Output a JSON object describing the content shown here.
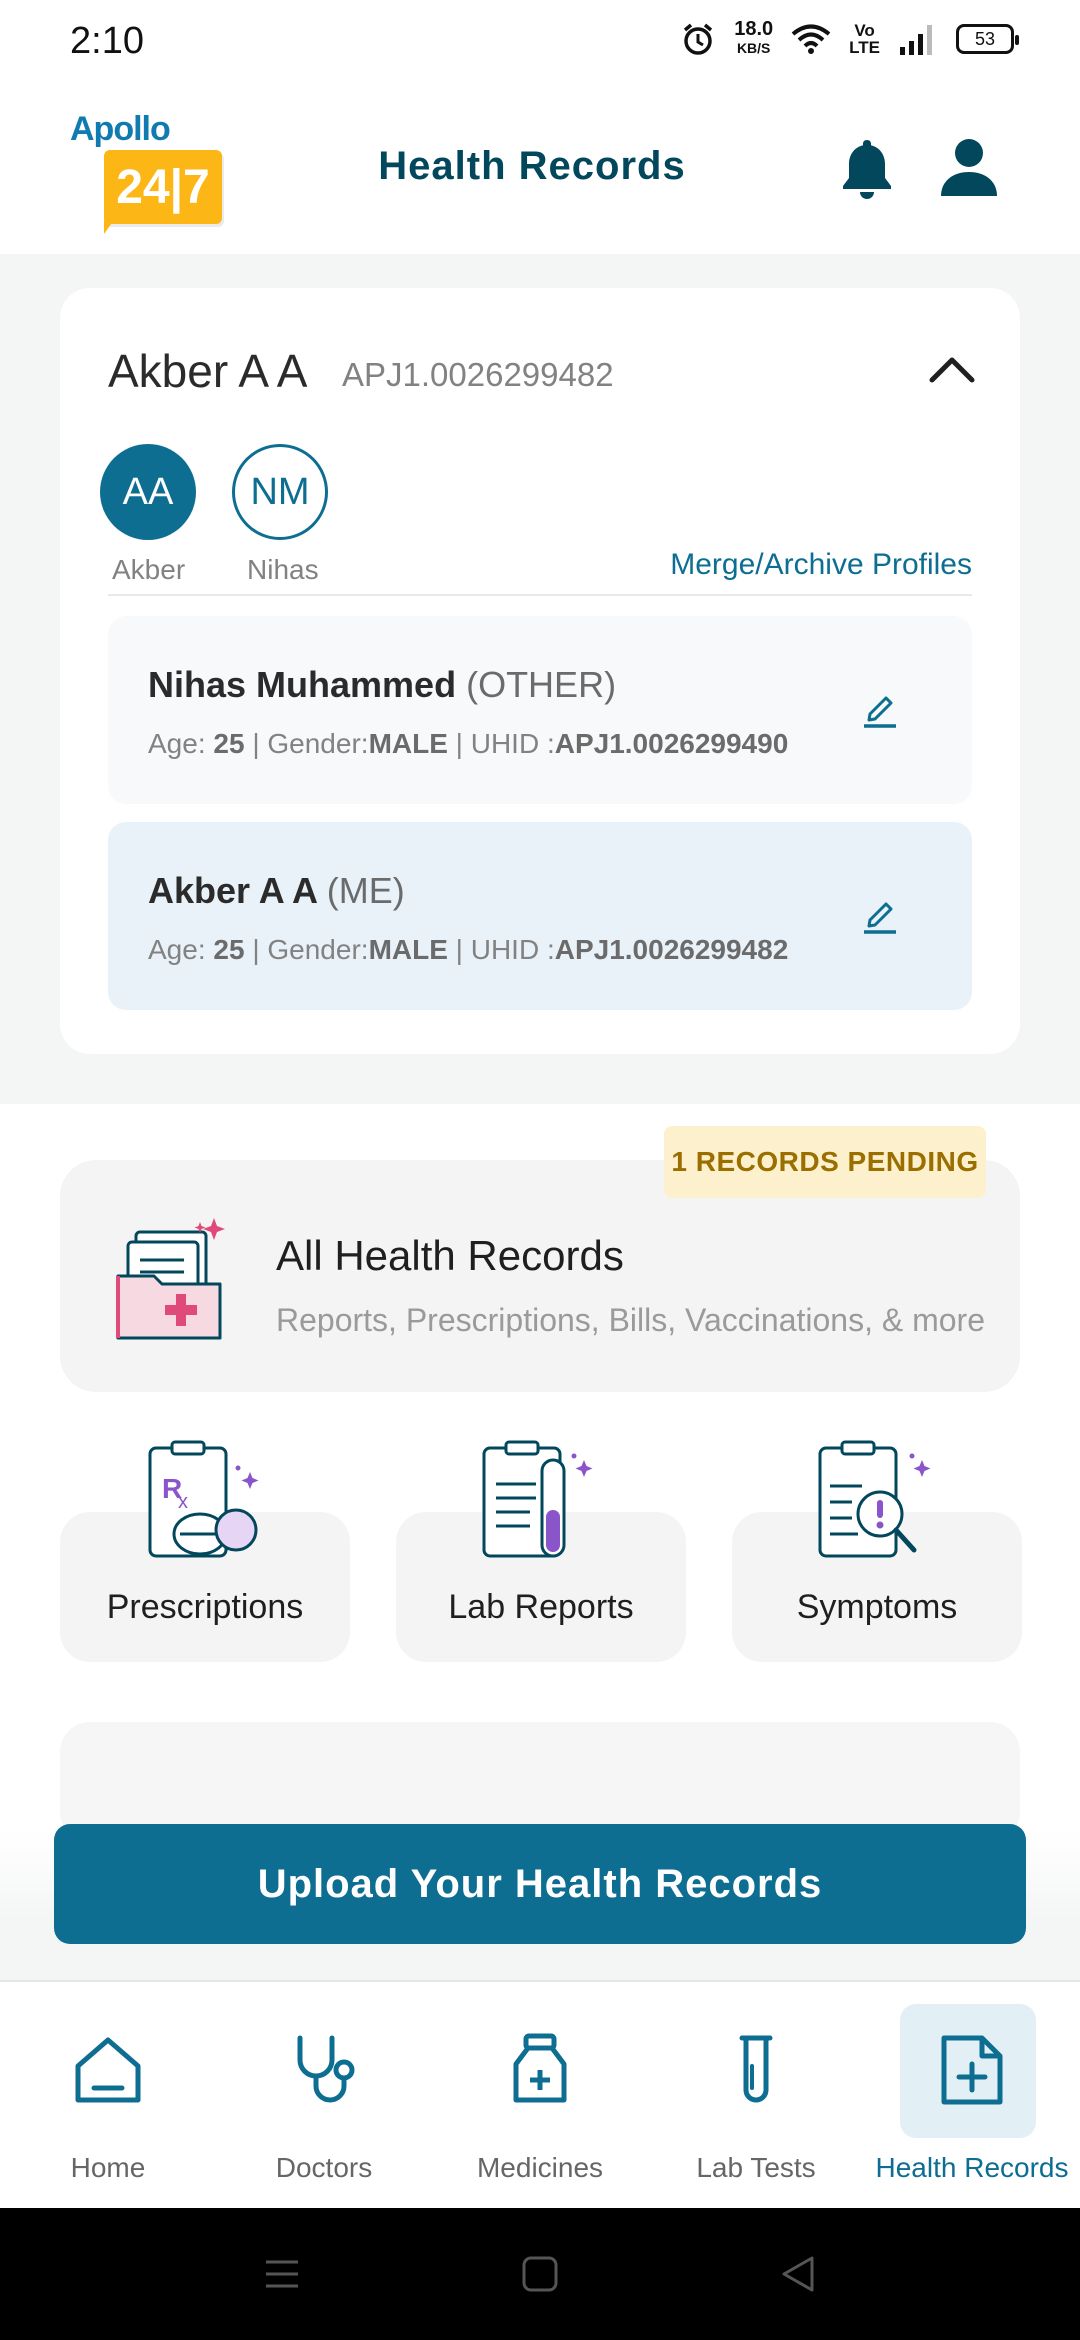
{
  "status_bar": {
    "time": "2:10",
    "net_speed_value": "18.0",
    "net_speed_unit": "KB/S",
    "volte_line1": "Vo",
    "volte_line2": "LTE",
    "battery": "53"
  },
  "header": {
    "logo_top": "Apollo",
    "logo_box": "24|7",
    "title": "Health Records"
  },
  "profile": {
    "name": "Akber A A",
    "uhid": "APJ1.0026299482",
    "avatars": [
      {
        "initials": "AA",
        "label": "Akber"
      },
      {
        "initials": "NM",
        "label": "Nihas"
      }
    ],
    "merge_link": "Merge/Archive Profiles",
    "members": [
      {
        "name": "Nihas Muhammed",
        "relation": "(OTHER)",
        "age_label": "Age: ",
        "age": "25",
        "gender_label": " | Gender:",
        "gender": "MALE",
        "uhid_label": " | UHID :",
        "uhid": "APJ1.0026299490"
      },
      {
        "name": "Akber A A",
        "relation": "(ME)",
        "age_label": "Age: ",
        "age": "25",
        "gender_label": " | Gender:",
        "gender": "MALE",
        "uhid_label": " | UHID :",
        "uhid": "APJ1.0026299482"
      }
    ]
  },
  "records": {
    "pending_badge": "1 RECORDS PENDING",
    "all_title": "All Health Records",
    "all_subtitle": "Reports, Prescriptions, Bills, Vaccinations, & more",
    "tiles": [
      {
        "label": "Prescriptions",
        "icon": "prescription-icon"
      },
      {
        "label": "Lab Reports",
        "icon": "lab-report-icon"
      },
      {
        "label": "Symptoms",
        "icon": "symptoms-icon"
      }
    ]
  },
  "upload_button": "Upload Your Health Records",
  "bottom_nav": {
    "items": [
      {
        "label": "Home",
        "icon": "home-icon"
      },
      {
        "label": "Doctors",
        "icon": "stethoscope-icon"
      },
      {
        "label": "Medicines",
        "icon": "medicine-bottle-icon"
      },
      {
        "label": "Lab Tests",
        "icon": "test-tube-icon"
      },
      {
        "label": "Health Records",
        "icon": "health-record-icon"
      }
    ],
    "active": "Health Records"
  },
  "colors": {
    "primary": "#0d6e92",
    "title": "#02475b",
    "badge_bg": "#fdf1cd",
    "badge_text": "#9a6f00",
    "logo_yellow": "#fcb716"
  }
}
